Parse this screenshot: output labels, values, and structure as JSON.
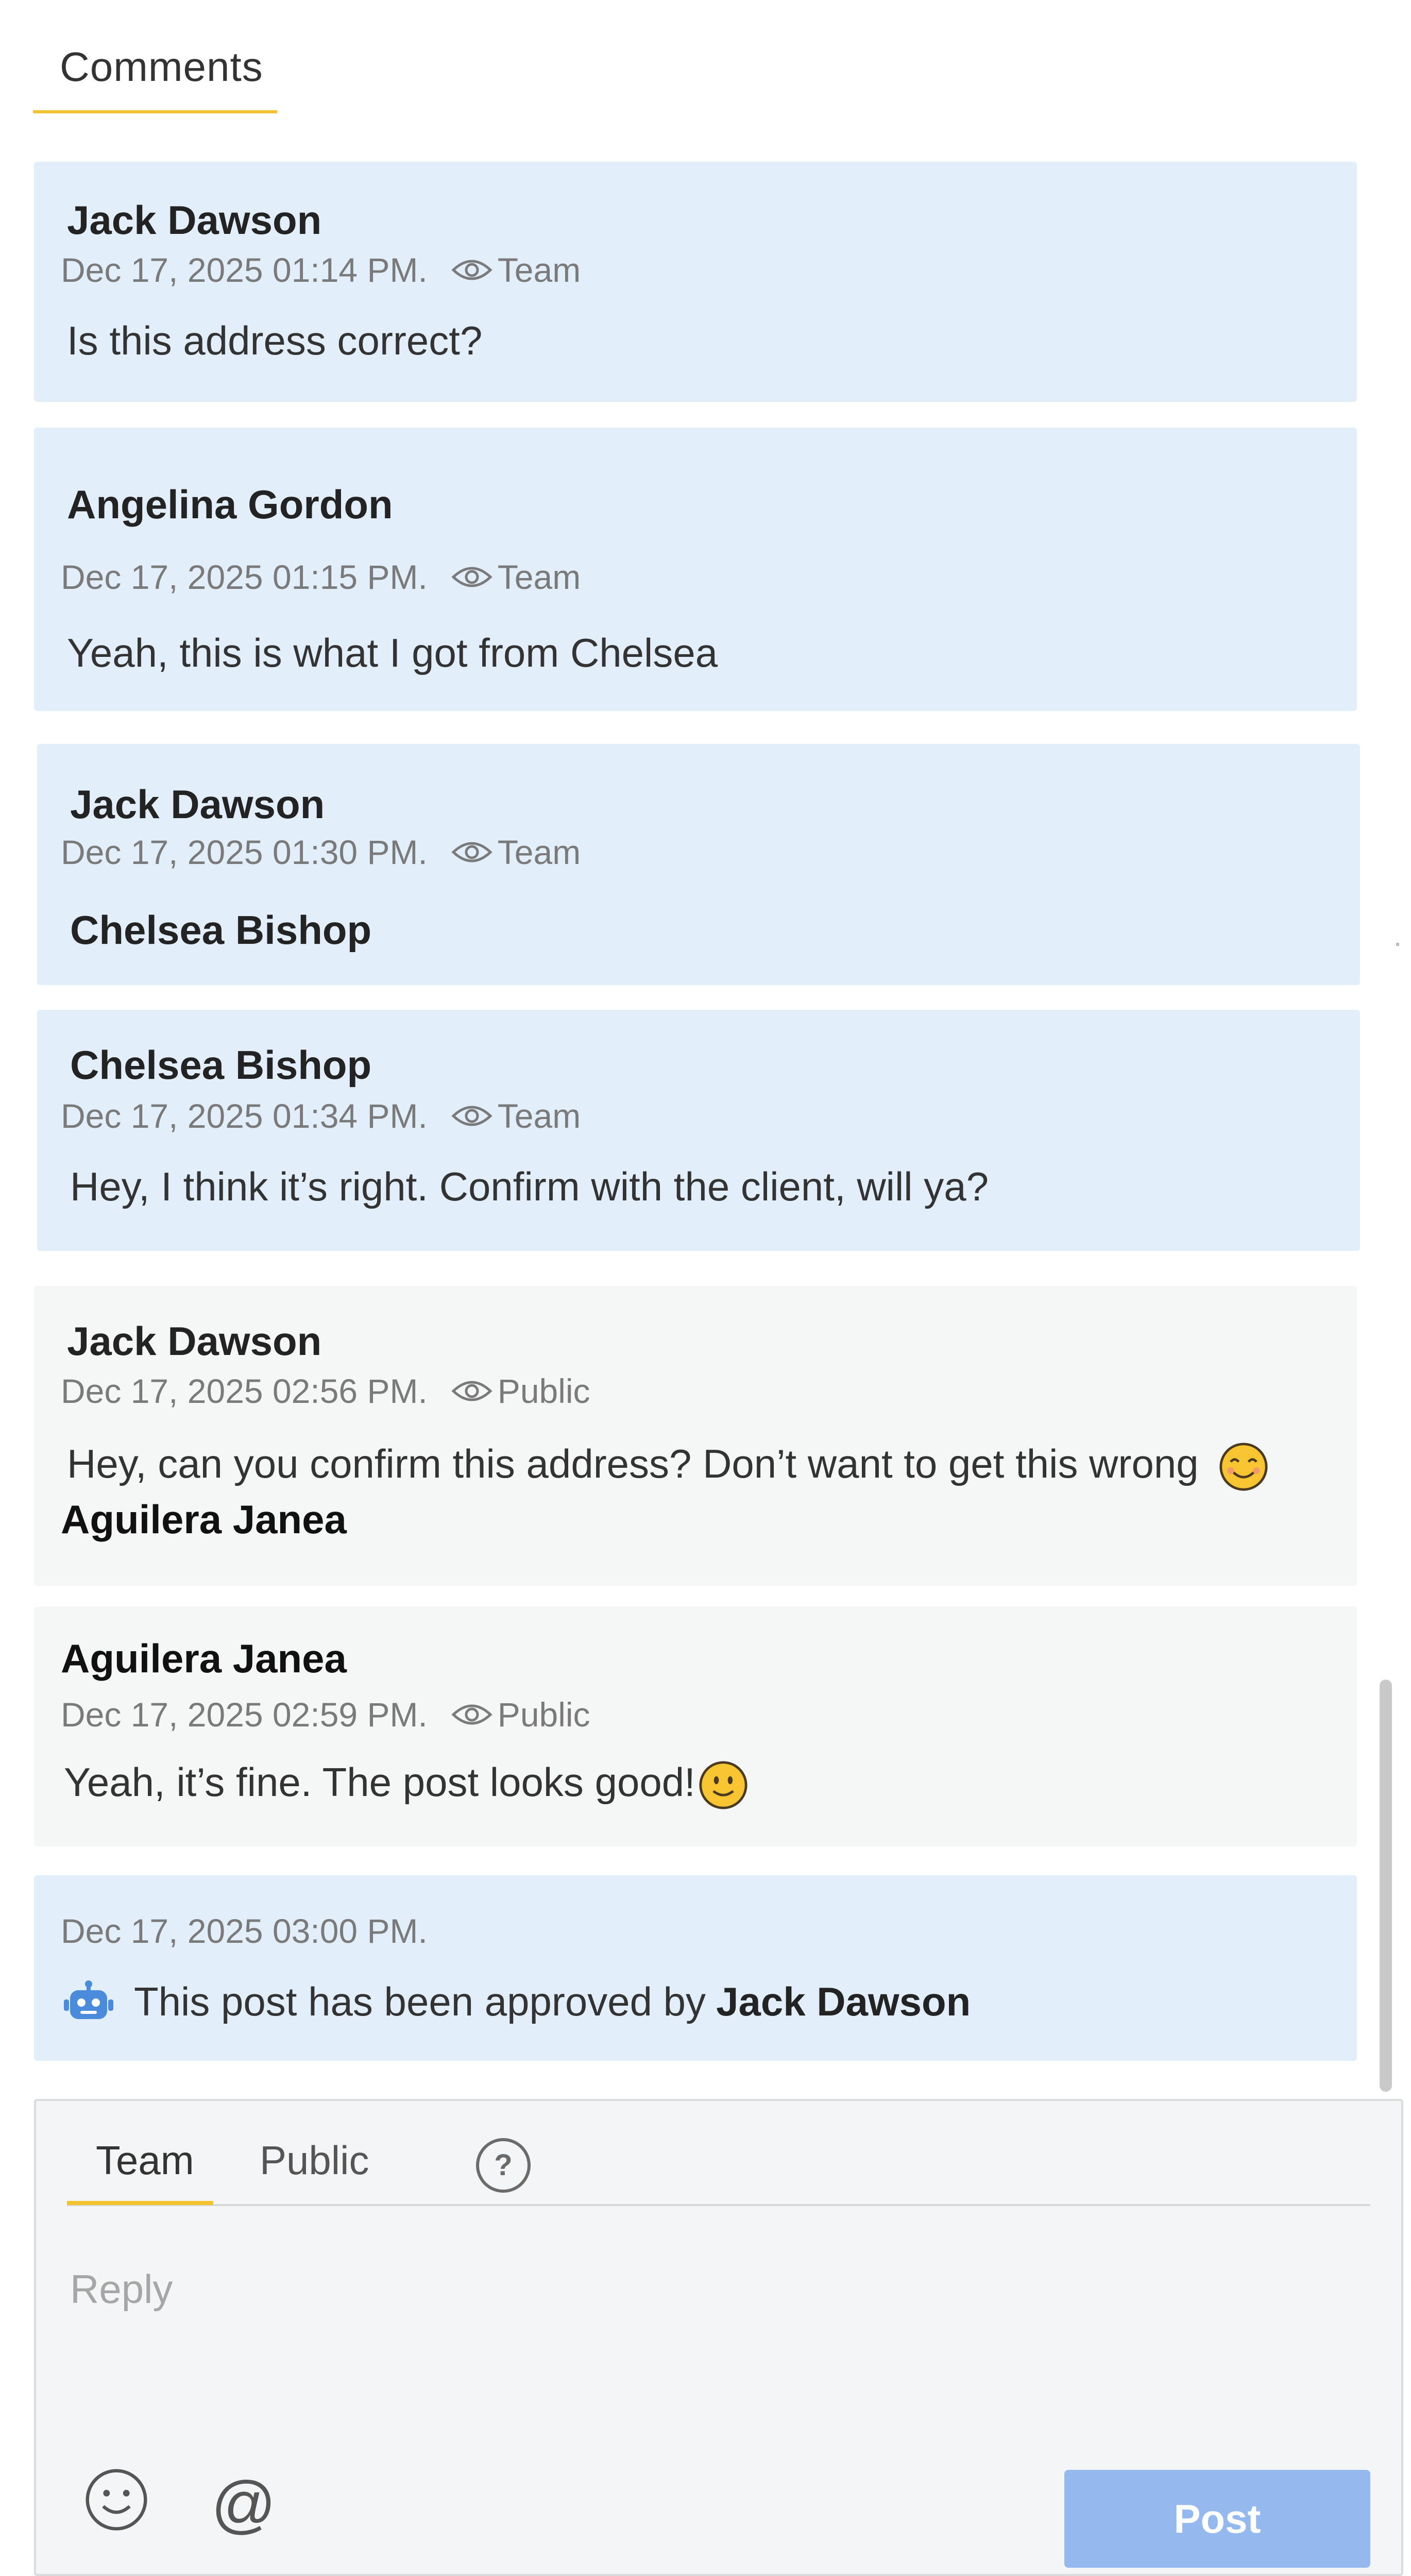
{
  "header": {
    "tab_label": "Comments"
  },
  "comments": [
    {
      "author": "Jack Dawson",
      "timestamp": "Dec 17, 2025 01:14 PM.",
      "visibility": "Team",
      "text": "Is this address correct?"
    },
    {
      "author": "Angelina Gordon",
      "timestamp": "Dec 17, 2025 01:15 PM.",
      "visibility": "Team",
      "text": "Yeah, this is what I got from Chelsea"
    },
    {
      "author": "Jack Dawson",
      "timestamp": "Dec 17, 2025 01:30 PM.",
      "visibility": "Team",
      "mention": "Chelsea Bishop"
    },
    {
      "author": "Chelsea Bishop",
      "timestamp": "Dec 17, 2025 01:34 PM.",
      "visibility": "Team",
      "text": "Hey, I think it’s right. Confirm with the client, will ya?"
    },
    {
      "author": "Jack Dawson",
      "timestamp": "Dec 17, 2025 02:56 PM.",
      "visibility": "Public",
      "text": "Hey, can you confirm this address? Don’t want to get this wrong",
      "mention": "Aguilera Janea"
    },
    {
      "author": "Aguilera Janea",
      "timestamp": "Dec 17, 2025 02:59 PM.",
      "visibility": "Public",
      "text": "Yeah, it’s fine. The post looks good!"
    }
  ],
  "system_message": {
    "timestamp": "Dec 17, 2025 03:00 PM.",
    "text": "This post has been approved by",
    "actor": "Jack Dawson",
    "icon": "robot-icon"
  },
  "reply": {
    "tabs": [
      "Team",
      "Public"
    ],
    "active_tab": "Team",
    "placeholder": "Reply",
    "post_label": "Post",
    "at_symbol": "@"
  },
  "colors": {
    "team_bg": "#e3eefb",
    "public_bg": "#f5f7f7",
    "accent": "#f2c230",
    "post_button": "#93b9ee"
  }
}
